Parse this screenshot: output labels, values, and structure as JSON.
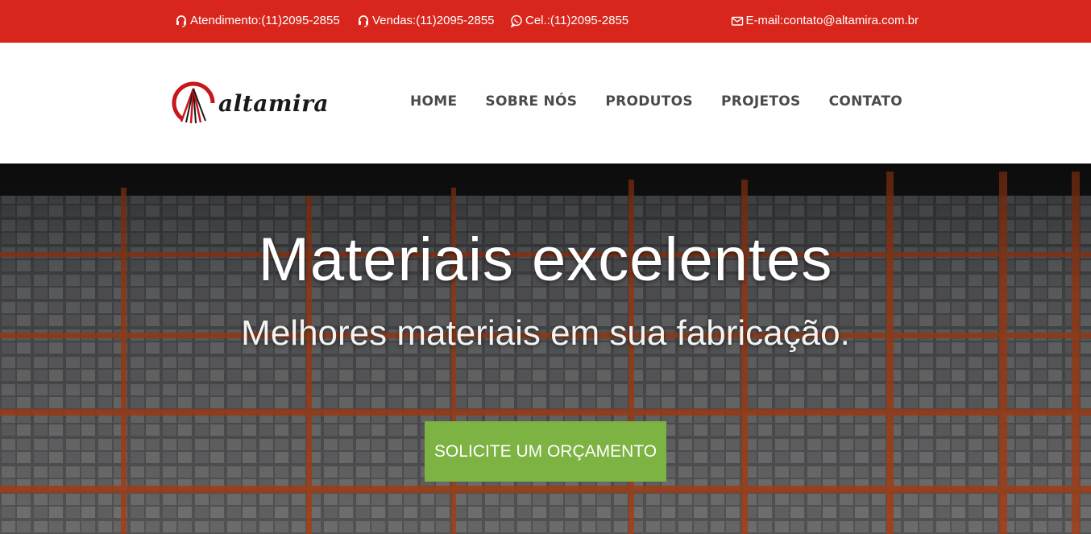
{
  "topbar": {
    "atendimento": "Atendimento:(11)2095-2855",
    "vendas": "Vendas:(11)2095-2855",
    "celular": "Cel.:(11)2095-2855",
    "email": "E-mail:contato@altamira.com.br",
    "icons": [
      "headset-icon",
      "headset-icon",
      "whatsapp-icon",
      "envelope-icon"
    ],
    "color": "#d9261c"
  },
  "header": {
    "logo_text": "altamira",
    "nav": [
      "HOME",
      "SOBRE NÓS",
      "PRODUTOS",
      "PROJETOS",
      "CONTATO"
    ]
  },
  "hero": {
    "title": "Materiais excelentes",
    "subtitle": "Melhores materiais em sua fabricação.",
    "cta_label": "SOLICITE UM ORÇAMENTO",
    "cta_color": "#7cb342"
  }
}
